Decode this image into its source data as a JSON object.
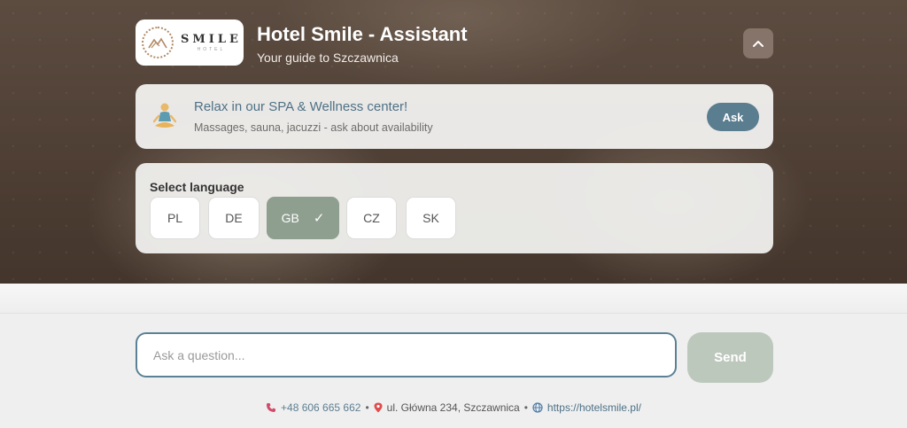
{
  "header": {
    "logo_word": "SMILE",
    "logo_sub": "HOTEL",
    "title": "Hotel Smile - Assistant",
    "subtitle": "Your guide to Szczawnica",
    "collapse_icon": "chevron-up-icon"
  },
  "promo": {
    "icon": "meditation-icon",
    "title": "Relax in our SPA & Wellness center!",
    "text": "Massages, sauna, jacuzzi - ask about availability",
    "button_label": "Ask"
  },
  "language": {
    "label": "Select language",
    "options": [
      {
        "code": "PL"
      },
      {
        "code": "DE"
      },
      {
        "code": "GB",
        "selected": true
      },
      {
        "code": "CZ"
      },
      {
        "code": "SK"
      }
    ],
    "check_glyph": "✓"
  },
  "chat": {
    "input_placeholder": "Ask a question...",
    "input_value": "",
    "send_label": "Send"
  },
  "footer": {
    "phone": "+48 606 665 662",
    "address": "ul. Główna 234, Szczawnica",
    "website": "https://hotelsmile.pl/",
    "separator": "•"
  },
  "colors": {
    "accent": "#5a7d90",
    "selected_language": "#8e9f8f",
    "send_button": "#bdc8bd"
  }
}
